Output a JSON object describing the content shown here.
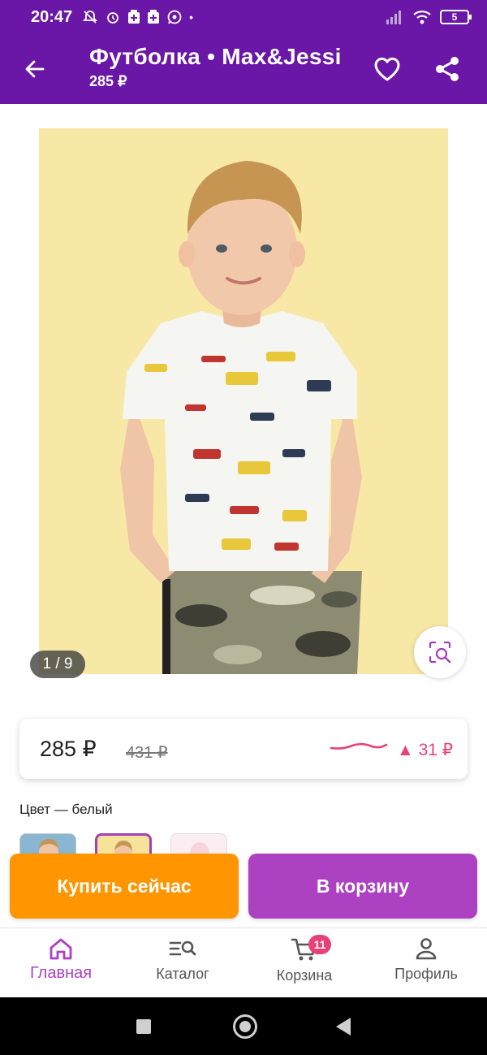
{
  "status_bar": {
    "time": "20:47",
    "battery": "5",
    "icons": [
      "mute-bell-icon",
      "alarm-icon",
      "notification-icon",
      "notification-icon",
      "whatsapp-icon",
      "signal-icon",
      "wifi-icon",
      "battery-icon"
    ]
  },
  "app_bar": {
    "title": "Футболка • Max&Jessi",
    "subtitle": "285 ₽"
  },
  "gallery": {
    "counter": "1 / 9",
    "current": 1,
    "total": 9
  },
  "price": {
    "current": "285 ₽",
    "old": "431 ₽",
    "change": "▲ 31 ₽"
  },
  "color": {
    "label": "Цвет — белый",
    "selected_index": 1
  },
  "actions": {
    "buy_now": "Купить сейчас",
    "add_to_cart": "В корзину"
  },
  "nav": {
    "items": [
      {
        "label": "Главная",
        "icon": "home-icon",
        "active": true
      },
      {
        "label": "Каталог",
        "icon": "catalog-search-icon",
        "active": false
      },
      {
        "label": "Корзина",
        "icon": "cart-icon",
        "active": false,
        "badge": "11"
      },
      {
        "label": "Профиль",
        "icon": "profile-icon",
        "active": false
      }
    ]
  },
  "colors": {
    "primary": "#6a17a8",
    "accent": "#ac41c2",
    "buy": "#ff9500",
    "price_up": "#e8417a"
  }
}
